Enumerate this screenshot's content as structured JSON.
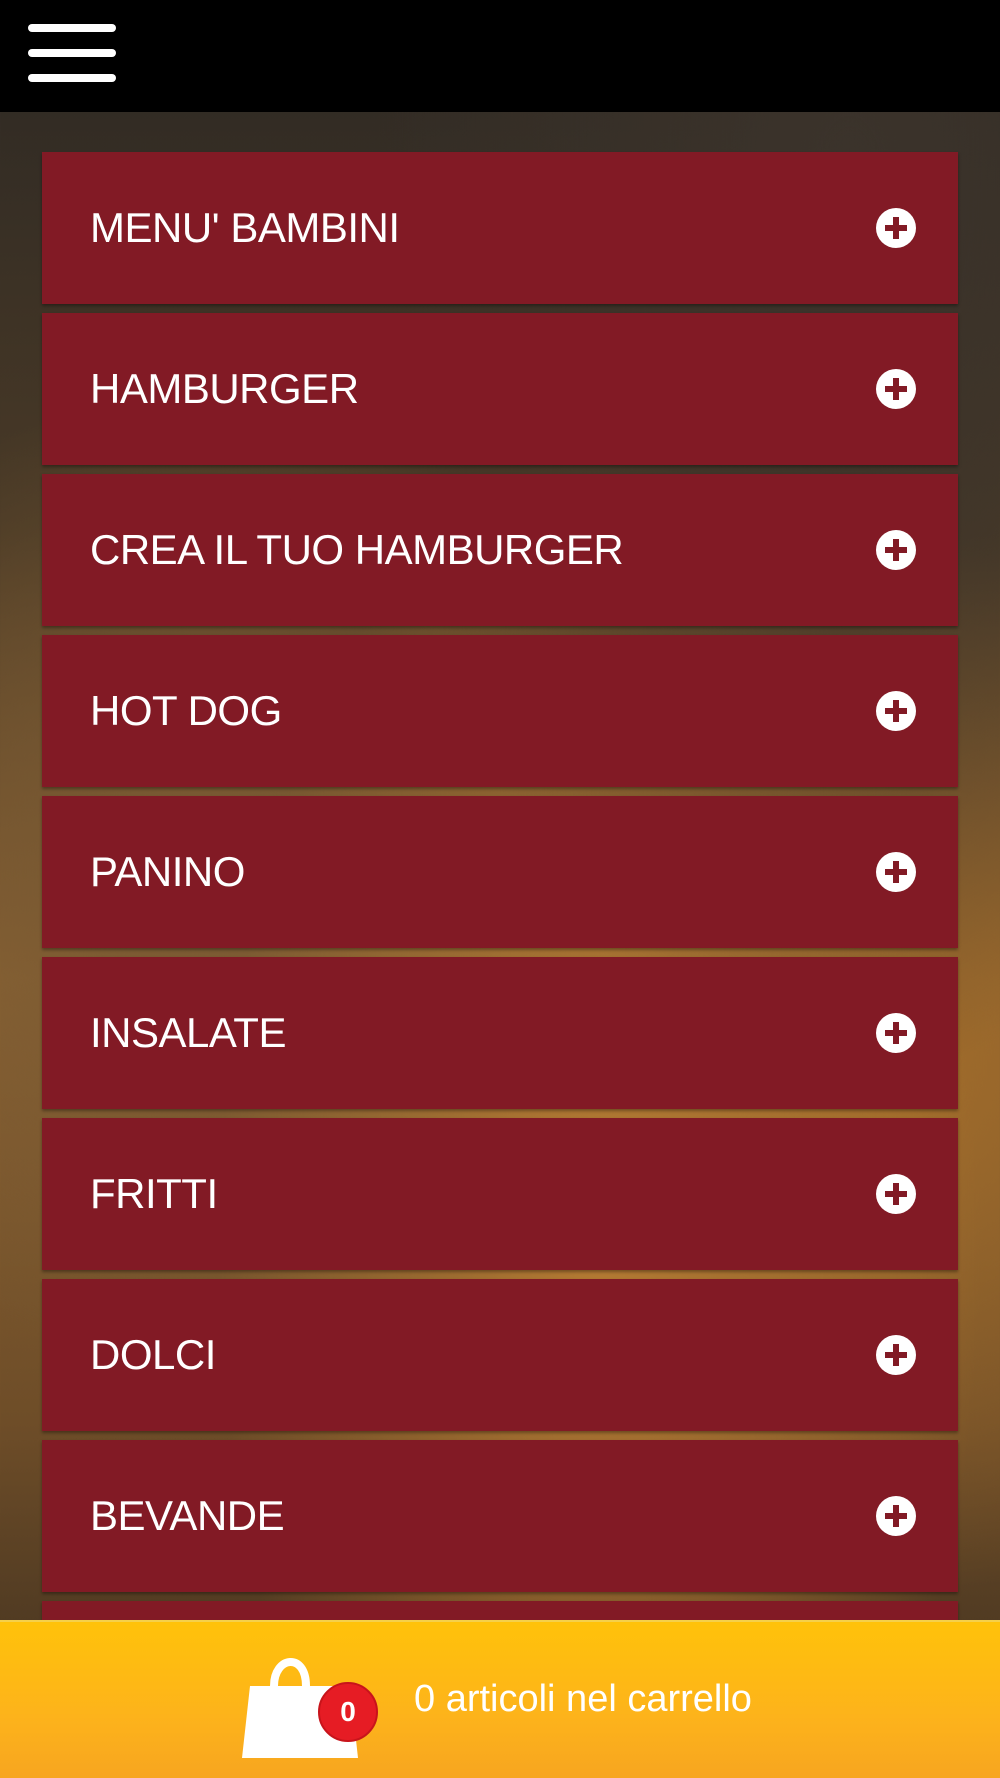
{
  "header": {
    "menu_icon": "hamburger-menu-icon"
  },
  "menu": {
    "items": [
      {
        "label": "MENU' BAMBINI",
        "icon": "plus-circle-icon"
      },
      {
        "label": "HAMBURGER",
        "icon": "plus-circle-icon"
      },
      {
        "label": "CREA IL TUO HAMBURGER",
        "icon": "plus-circle-icon"
      },
      {
        "label": "HOT DOG",
        "icon": "plus-circle-icon"
      },
      {
        "label": "PANINO",
        "icon": "plus-circle-icon"
      },
      {
        "label": "INSALATE",
        "icon": "plus-circle-icon"
      },
      {
        "label": "FRITTI",
        "icon": "plus-circle-icon"
      },
      {
        "label": "DOLCI",
        "icon": "plus-circle-icon"
      },
      {
        "label": "BEVANDE",
        "icon": "plus-circle-icon"
      }
    ]
  },
  "cart": {
    "icon": "shopping-bag-icon",
    "count": "0",
    "text": "0 articoli nel carrello"
  },
  "colors": {
    "menu_item_bg": "#821a25",
    "cart_bar": "#fdb31b",
    "badge": "#e61c24",
    "header_bg": "#000000"
  }
}
